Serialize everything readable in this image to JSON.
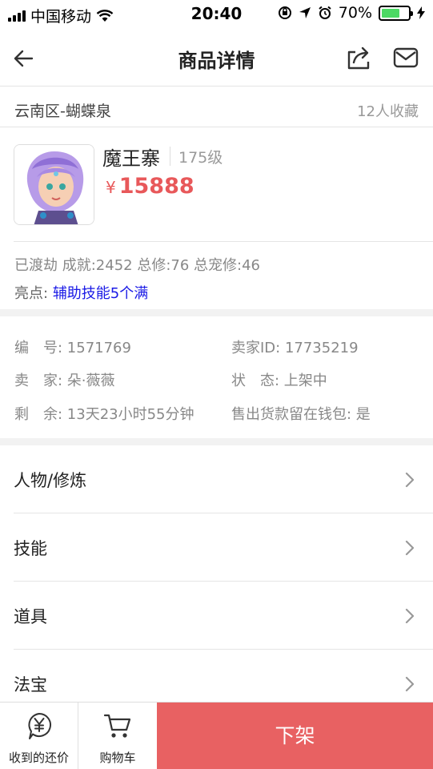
{
  "status_bar": {
    "carrier": "中国移动",
    "time": "20:40",
    "battery": "70%",
    "battery_level": 0.7
  },
  "nav": {
    "title": "商品详情",
    "icons": [
      "back-arrow-icon",
      "share-icon",
      "mail-icon"
    ]
  },
  "location": {
    "server": "云南区-蝴蝶泉",
    "favorites": "12人收藏"
  },
  "product": {
    "name": "魔王寨",
    "level": "175级",
    "currency": "¥",
    "price": "15888",
    "stats": "已渡劫 成就:2452 总修:76 总宠修:46",
    "highlight_label": "亮点:",
    "highlight_value": "辅助技能5个满"
  },
  "info": {
    "number": "编　号: 1571769",
    "seller_id": "卖家ID: 17735219",
    "seller": "卖　家: 朵·薇薇",
    "status": "状　态: 上架中",
    "remaining": "剩　余: 13天23小时55分钟",
    "wallet": "售出货款留在钱包: 是"
  },
  "menu": [
    {
      "label": "人物/修炼"
    },
    {
      "label": "技能"
    },
    {
      "label": "道具"
    },
    {
      "label": "法宝"
    }
  ],
  "bottom": {
    "offers_label": "收到的还价",
    "cart_label": "购物车",
    "action_label": "下架"
  },
  "colors": {
    "price": "#e8585a",
    "highlight": "#1a1ae6",
    "action": "#e86162",
    "battery": "#4cd964"
  }
}
